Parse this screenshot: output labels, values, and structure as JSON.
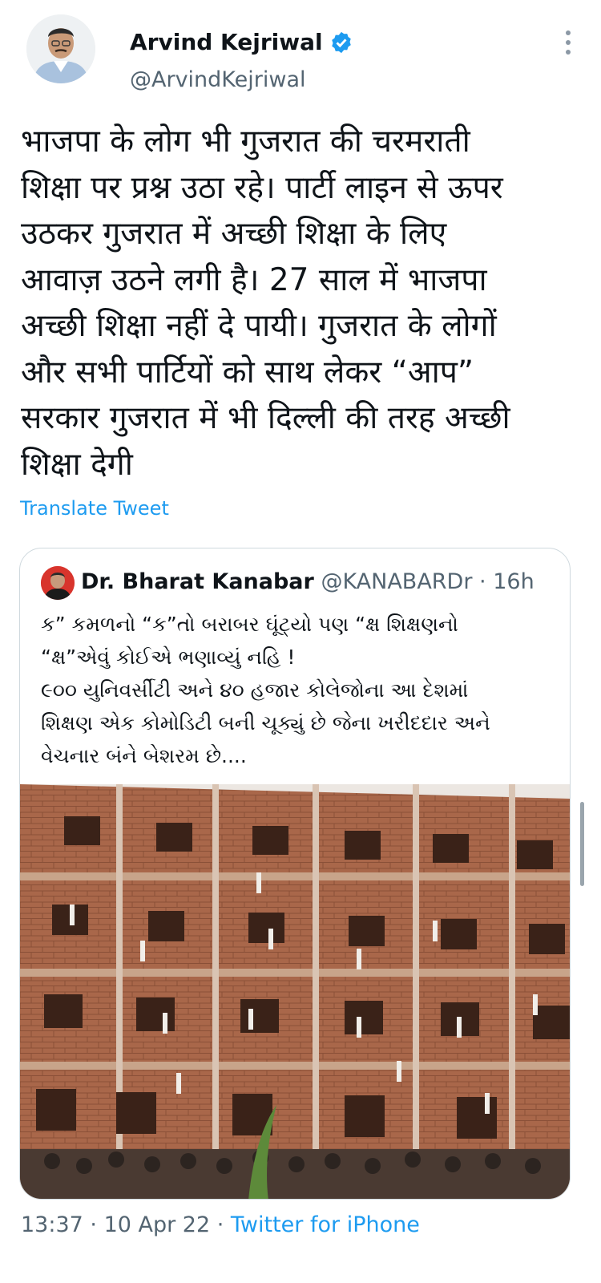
{
  "tweet": {
    "author_name": "Arvind Kejriwal",
    "author_handle": "@ArvindKejriwal",
    "text": "भाजपा के लोग भी गुजरात की चरमराती\nशिक्षा पर प्रश्न उठा रहे। पार्टी लाइन से ऊपर\nउठकर गुजरात में अच्छी शिक्षा के लिए\nआवाज़ उठने लगी है। 27 साल में भाजपा\nअच्छी शिक्षा नहीं दे पायी। गुजरात के लोगों\nऔर सभी पार्टियों को साथ लेकर “आप”\nसरकार गुजरात में भी दिल्ली की तरह अच्छी\nशिक्षा देगी",
    "translate_label": "Translate Tweet",
    "time": "13:37",
    "date": "10 Apr 22",
    "source": "Twitter for iPhone",
    "separator": " · "
  },
  "quoted": {
    "author_name": "Dr. Bharat Kanabar",
    "author_handle": "@KANABARDr",
    "age": "· 16h",
    "text": "ક” કમળનો “ક”તો બરાબર ઘૂંટ્યો પણ “ક્ષ શિક્ષણનો\n“ક્ષ”એવું કોઈએ ભણાવ્યું નહિ !\n૯૦૦ યુનિવર્સીટી અને ૪૦ હજાર કોલેજોના આ દેશમાં\nશિક્ષણ એક કોમોડિટી બની ચૂક્યું છે જેના ખરીદદાર અને\nવેચનાર બંને બેશરમ છે...."
  },
  "colors": {
    "link": "#1d9bf0",
    "secondary_text": "#536471",
    "border": "#cfd9de",
    "brick": "#a9674a"
  },
  "icons": {
    "verified": "verified-badge-icon",
    "more": "more-vertical-icon"
  }
}
